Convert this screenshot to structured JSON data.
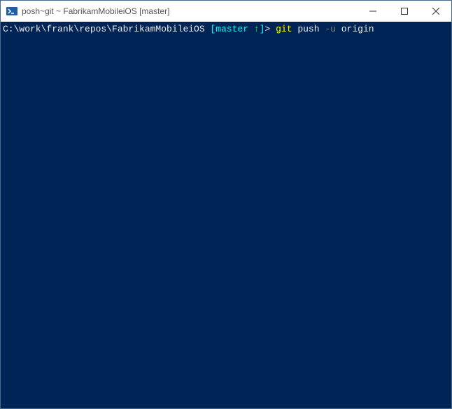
{
  "window": {
    "title": "posh~git ~ FabrikamMobileiOS [master]",
    "icon": "powershell-icon"
  },
  "controls": {
    "minimize": "minimize",
    "maximize": "maximize",
    "close": "close"
  },
  "prompt": {
    "path": "C:\\work\\frank\\repos\\FabrikamMobileiOS",
    "branch_open": " [",
    "branch": "master",
    "branch_indicator": " ↑",
    "branch_close": "]",
    "caret": "> ",
    "cmd_git": "git",
    "cmd_push": " push ",
    "cmd_flag": "-u",
    "cmd_origin": " origin"
  }
}
